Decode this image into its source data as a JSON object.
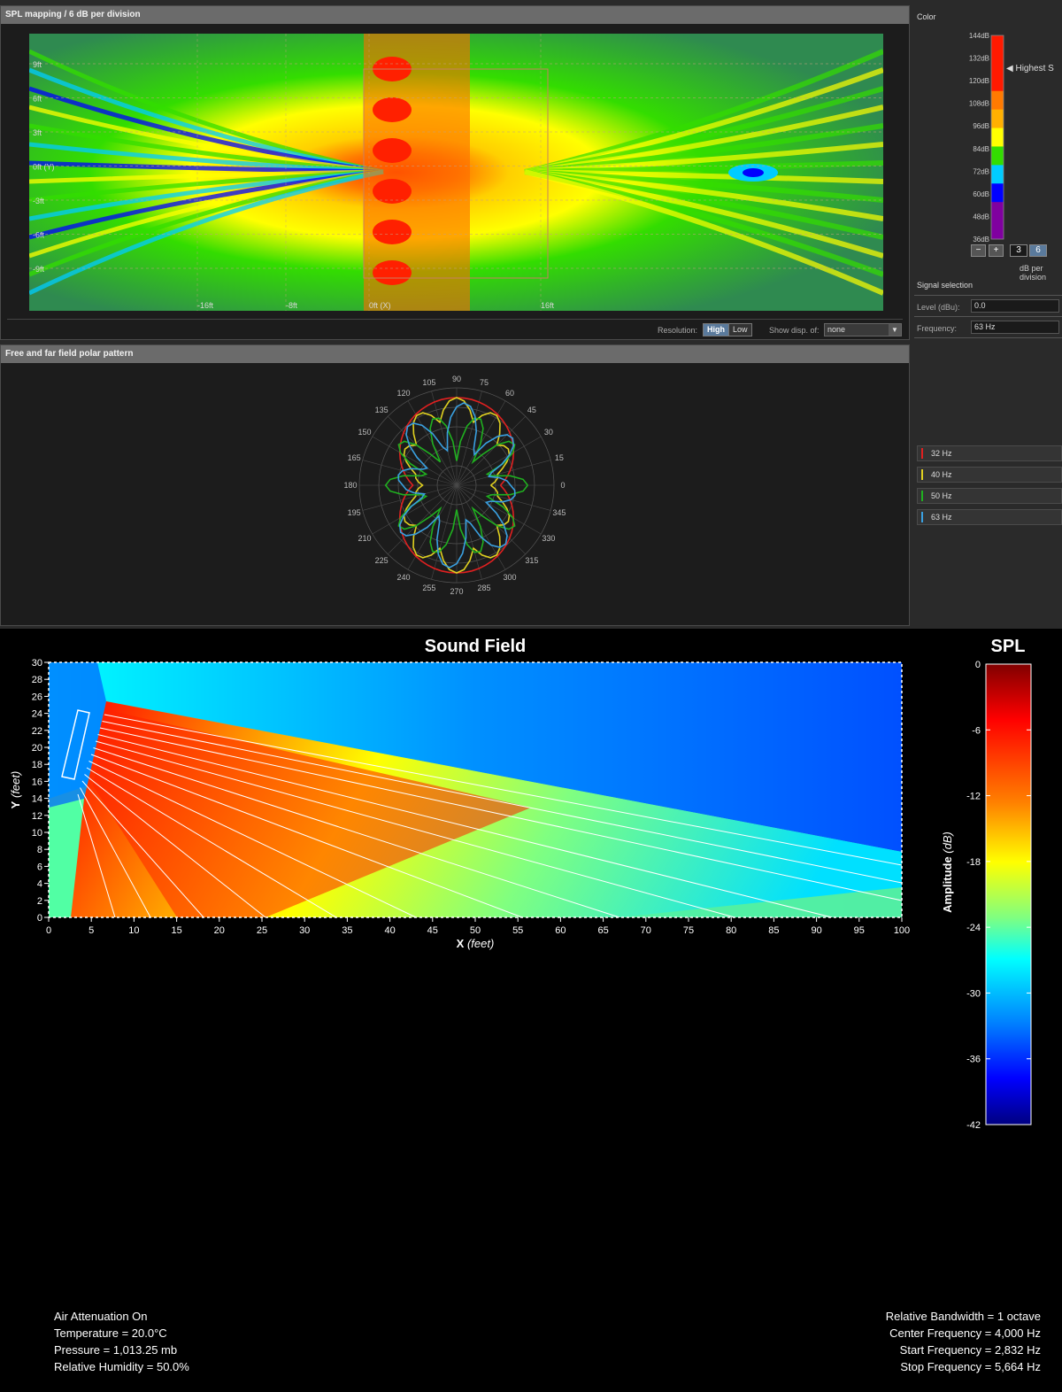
{
  "spl_panel": {
    "title": "SPL mapping / 6 dB per division",
    "grid_labels": [
      "9ft",
      "6ft",
      "3ft",
      "0ft (Y)",
      "-3ft",
      "-6ft",
      "-9ft"
    ],
    "x_labels": [
      "-16ft",
      "-8ft",
      "0ft (X)",
      "16ft"
    ],
    "resolution_label": "Resolution:",
    "resolution_high": "High",
    "resolution_low": "Low",
    "show_disp_label": "Show disp. of:",
    "show_disp_value": "none"
  },
  "color_panel": {
    "title": "Color",
    "scale_labels": [
      "144dB",
      "132dB",
      "120dB",
      "108dB",
      "96dB",
      "84dB",
      "72dB",
      "60dB",
      "48dB",
      "36dB"
    ],
    "scale_colors": [
      "#ff1a00",
      "#ff1a00",
      "#ff1a00",
      "#ff7a00",
      "#ffb000",
      "#ffff00",
      "#33dd00",
      "#00ccff",
      "#0000ff",
      "#8000a0",
      "#8000a0"
    ],
    "highest_label": "Highest S",
    "minus_label": "−",
    "plus_label": "+",
    "division_options": [
      "3",
      "6"
    ],
    "division_selected": "6",
    "division_caption": "dB per division"
  },
  "signal_selection": {
    "title": "Signal selection",
    "level_label": "Level (dBu):",
    "level_value": "0.0",
    "frequency_label": "Frequency:",
    "frequency_value": "63 Hz"
  },
  "polar_panel": {
    "title": "Free and far field polar pattern",
    "angle_labels": [
      "90",
      "105",
      "75",
      "120",
      "60",
      "135",
      "45",
      "150",
      "30",
      "165",
      "15",
      "180",
      "0",
      "195",
      "345",
      "210",
      "330",
      "225",
      "315",
      "240",
      "300",
      "255",
      "285",
      "270"
    ],
    "series": [
      {
        "name": "32 Hz",
        "color": "#e02020"
      },
      {
        "name": "40 Hz",
        "color": "#e0d020"
      },
      {
        "name": "50 Hz",
        "color": "#20b020"
      },
      {
        "name": "63 Hz",
        "color": "#3aa0e0"
      }
    ]
  },
  "sound_field": {
    "title": "Sound Field",
    "x_axis_label": "X",
    "x_axis_unit": "(feet)",
    "y_axis_label": "Y",
    "y_axis_unit": "(feet)",
    "x_ticks": [
      0,
      5,
      10,
      15,
      20,
      25,
      30,
      35,
      40,
      45,
      50,
      55,
      60,
      65,
      70,
      75,
      80,
      85,
      90,
      95,
      100
    ],
    "y_ticks": [
      0,
      2,
      4,
      6,
      8,
      10,
      12,
      14,
      16,
      18,
      20,
      22,
      24,
      26,
      28,
      30
    ],
    "xlim": [
      0,
      100
    ],
    "ylim": [
      0,
      30
    ],
    "colorbar_title": "SPL",
    "colorbar_label": "Amplitude",
    "colorbar_unit": "(dB)",
    "colorbar_ticks": [
      0,
      -6,
      -12,
      -18,
      -24,
      -30,
      -36,
      -42
    ],
    "colorbar_range": [
      -42,
      0
    ],
    "colors": [
      "#800000",
      "#ff0000",
      "#ff8000",
      "#ffff00",
      "#80ff80",
      "#00ffff",
      "#0080ff",
      "#0000ff",
      "#000080"
    ]
  },
  "air_info": {
    "line1": "Air Attenuation On",
    "line2": "Temperature = 20.0°C",
    "line3": "Pressure = 1,013.25  mb",
    "line4": "Relative Humidity = 50.0%"
  },
  "band_info": {
    "line1": "Relative Bandwidth = 1 octave",
    "line2": "Center Frequency = 4,000 Hz",
    "line3": "Start Frequency = 2,832 Hz",
    "line4": "Stop Frequency = 5,664 Hz"
  }
}
